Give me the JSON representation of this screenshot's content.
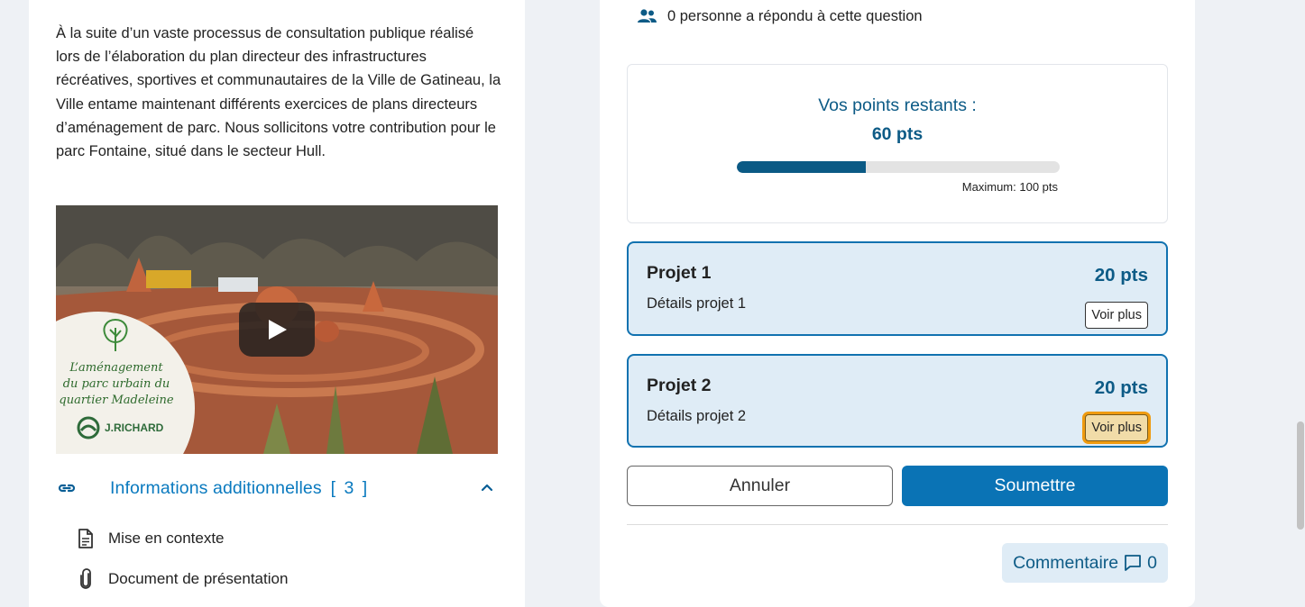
{
  "intro": {
    "text": "À la suite d’un vaste processus de consultation publique réalisé lors de l’élaboration du plan directeur des infrastructures récréatives, sportives et communautaires de la Ville de Gatineau, la Ville entame maintenant différents exercices de plans directeurs d’aménagement de parc. Nous sollicitons votre contribution pour le parc Fontaine, situé dans le secteur Hull."
  },
  "video": {
    "badge_line1": "L’aménagement",
    "badge_line2": "du parc urbain du",
    "badge_line3": "quartier Madeleine",
    "brand": "J.RICHARD"
  },
  "info": {
    "title": "Informations additionnelles",
    "count": "[ 3 ]",
    "items": [
      {
        "label": "Mise en contexte",
        "icon": "document-icon"
      },
      {
        "label": "Document de présentation",
        "icon": "paperclip-icon"
      }
    ]
  },
  "question": {
    "respondents": "0 personne a répondu à cette question",
    "points_label": "Vos points restants :",
    "points_value": "60 pts",
    "points_remaining": 60,
    "points_max": 100,
    "max_label": "Maximum: 100 pts"
  },
  "projects": [
    {
      "title": "Projet 1",
      "points": "20 pts",
      "details": "Détails projet 1",
      "more": "Voir plus"
    },
    {
      "title": "Projet 2",
      "points": "20 pts",
      "details": "Détails projet 2",
      "more": "Voir plus"
    }
  ],
  "actions": {
    "cancel": "Annuler",
    "submit": "Soumettre",
    "comment_label": "Commentaire",
    "comment_count": "0"
  },
  "colors": {
    "accent": "#0a73b5",
    "dark_blue": "#0d5b86",
    "card_bg": "#dfecf6",
    "focus_ring": "#ef9b10"
  }
}
